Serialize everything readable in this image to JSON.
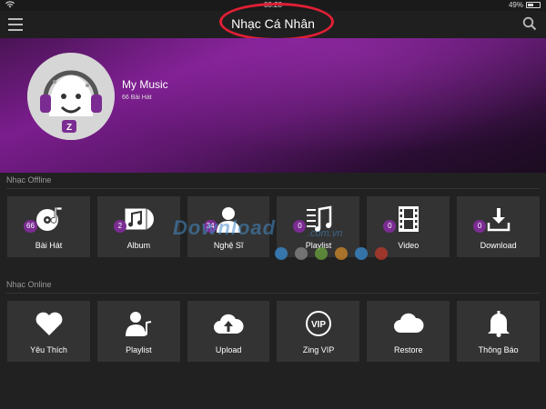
{
  "status": {
    "time": "08:28",
    "battery": "49%",
    "battery_level": 0.49
  },
  "topbar": {
    "title": "Nhạc Cá Nhân",
    "menu_icon": "hamburger-menu-icon",
    "search_icon": "search-icon"
  },
  "profile": {
    "name": "My Music",
    "song_count": "66 Bài Hát"
  },
  "offline": {
    "label": "Nhạc Offline",
    "items": [
      {
        "label": "Bài Hát",
        "badge": "66",
        "icon": "disc-music-icon"
      },
      {
        "label": "Album",
        "badge": "2",
        "icon": "album-icon"
      },
      {
        "label": "Nghệ Sĩ",
        "badge": "34",
        "icon": "artist-icon"
      },
      {
        "label": "Playlist",
        "badge": "0",
        "icon": "playlist-icon"
      },
      {
        "label": "Video",
        "badge": "0",
        "icon": "film-icon"
      },
      {
        "label": "Download",
        "badge": "0",
        "icon": "download-icon"
      }
    ]
  },
  "online": {
    "label": "Nhạc Online",
    "items": [
      {
        "label": "Yêu Thích",
        "icon": "heart-icon"
      },
      {
        "label": "Playlist",
        "icon": "online-playlist-icon"
      },
      {
        "label": "Upload",
        "icon": "cloud-upload-icon"
      },
      {
        "label": "Zing VIP",
        "icon": "vip-icon"
      },
      {
        "label": "Restore",
        "icon": "cloud-icon"
      },
      {
        "label": "Thông Báo",
        "icon": "bell-icon"
      }
    ]
  },
  "watermark": {
    "main": "Download",
    "sub": ".com.vn"
  },
  "colors": {
    "accent": "#7b2c92",
    "highlight_circle": "#e01f35",
    "tile": "#333333",
    "background": "#212121"
  }
}
